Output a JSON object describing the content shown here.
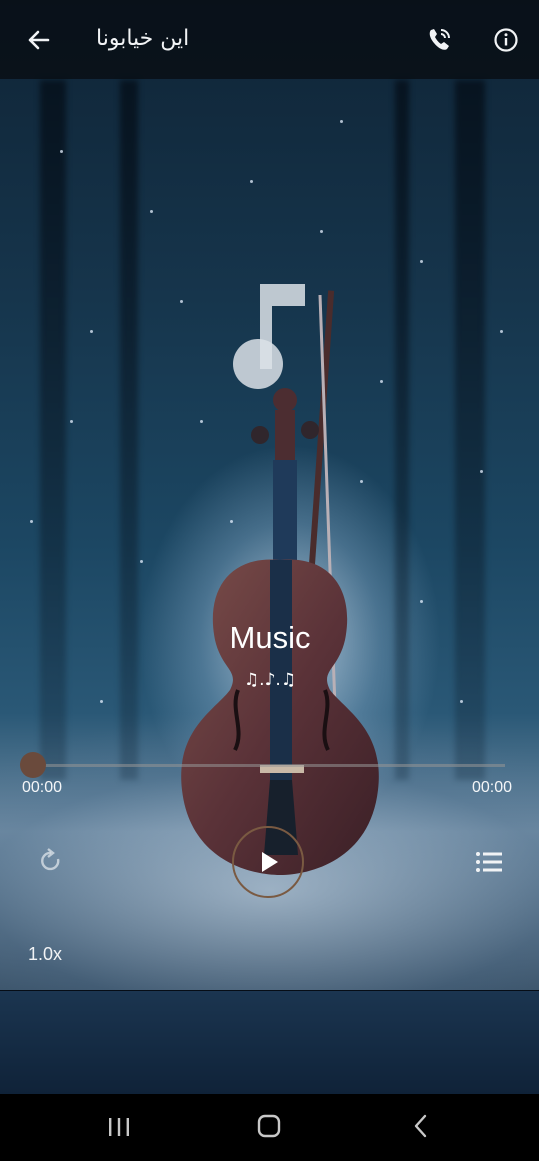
{
  "header": {
    "title": "این خیابونا",
    "back_icon": "arrow-left-icon",
    "call_icon": "phone-call-icon",
    "info_icon": "info-circle-icon"
  },
  "artwork": {
    "placeholder_icon": "music-note-icon"
  },
  "track": {
    "title": "Music",
    "artist": "♫.♪.♫"
  },
  "player": {
    "elapsed": "00:00",
    "duration": "00:00",
    "progress": 0,
    "speed": "1.0x",
    "repeat_icon": "repeat-icon",
    "play_icon": "play-icon",
    "playlist_icon": "playlist-icon"
  },
  "system_nav": {
    "recents_icon": "recents-icon",
    "home_icon": "home-icon",
    "back_icon": "chevron-left-icon"
  },
  "colors": {
    "accent": "#7a5a42",
    "seek_thumb": "#6a4a3c",
    "topbar_bg": "#0e141a",
    "navbar_bg": "#000000"
  }
}
